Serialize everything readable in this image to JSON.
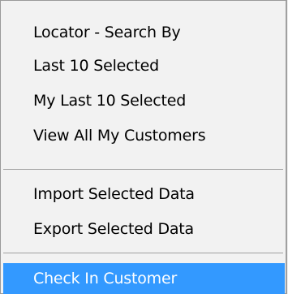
{
  "menu": {
    "items": [
      {
        "label": "Locator - Search By"
      },
      {
        "label": "Last 10 Selected"
      },
      {
        "label": "My Last 10 Selected"
      },
      {
        "label": "View All My Customers"
      },
      {
        "label": "Import Selected Data"
      },
      {
        "label": "Export Selected Data"
      },
      {
        "label": "Check In Customer"
      }
    ],
    "highlight_color": "#3399ff",
    "highlighted_item": "Check In Customer"
  }
}
